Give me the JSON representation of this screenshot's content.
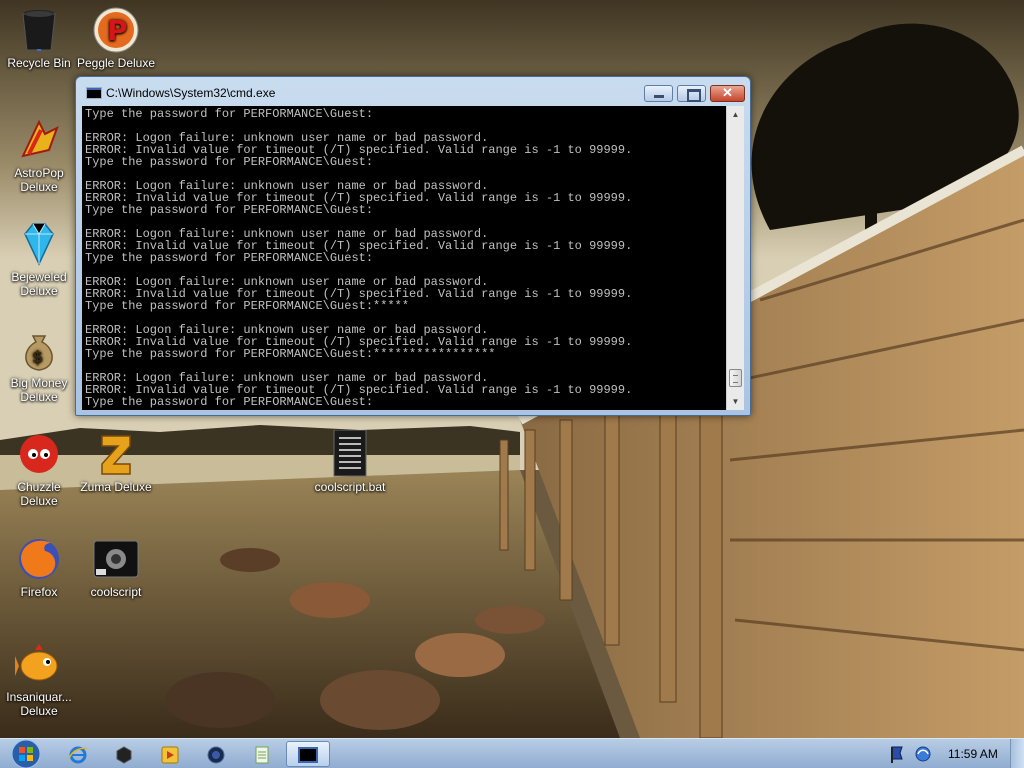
{
  "desktop": {
    "icons": [
      {
        "label": "Recycle Bin",
        "icon": "recycle-bin-icon"
      },
      {
        "label": "Peggle Deluxe",
        "icon": "peggle-icon"
      },
      {
        "label": "AstroPop Deluxe",
        "icon": "astropop-icon"
      },
      {
        "label": "Bejeweled Deluxe",
        "icon": "bejeweled-icon"
      },
      {
        "label": "Big Money Deluxe",
        "icon": "money-bag-icon"
      },
      {
        "label": "Chuzzle Deluxe",
        "icon": "chuzzle-icon"
      },
      {
        "label": "Zuma Deluxe",
        "icon": "zuma-icon"
      },
      {
        "label": "coolscript.bat",
        "icon": "batch-file-icon"
      },
      {
        "label": "Firefox",
        "icon": "firefox-icon"
      },
      {
        "label": "coolscript",
        "icon": "shortcut-icon"
      },
      {
        "label": "Insaniquar... Deluxe",
        "icon": "insaniquarium-icon"
      }
    ]
  },
  "window": {
    "title": "C:\\Windows\\System32\\cmd.exe",
    "console_lines": [
      "Type the password for PERFORMANCE\\Guest:",
      "",
      "ERROR: Logon failure: unknown user name or bad password.",
      "ERROR: Invalid value for timeout (/T) specified. Valid range is -1 to 99999.",
      "Type the password for PERFORMANCE\\Guest:",
      "",
      "ERROR: Logon failure: unknown user name or bad password.",
      "ERROR: Invalid value for timeout (/T) specified. Valid range is -1 to 99999.",
      "Type the password for PERFORMANCE\\Guest:",
      "",
      "ERROR: Logon failure: unknown user name or bad password.",
      "ERROR: Invalid value for timeout (/T) specified. Valid range is -1 to 99999.",
      "Type the password for PERFORMANCE\\Guest:",
      "",
      "ERROR: Logon failure: unknown user name or bad password.",
      "ERROR: Invalid value for timeout (/T) specified. Valid range is -1 to 99999.",
      "Type the password for PERFORMANCE\\Guest:*****",
      "",
      "ERROR: Logon failure: unknown user name or bad password.",
      "ERROR: Invalid value for timeout (/T) specified. Valid range is -1 to 99999.",
      "Type the password for PERFORMANCE\\Guest:*****************",
      "",
      "ERROR: Logon failure: unknown user name or bad password.",
      "ERROR: Invalid value for timeout (/T) specified. Valid range is -1 to 99999.",
      "Type the password for PERFORMANCE\\Guest:"
    ],
    "buttons": {
      "minimize": "minimize-icon",
      "maximize": "maximize-icon",
      "close": "close-icon"
    }
  },
  "taskbar": {
    "start": "windows-start-icon",
    "apps": [
      {
        "icon": "internet-explorer-icon",
        "active": false
      },
      {
        "icon": "cube-app-icon",
        "active": false
      },
      {
        "icon": "media-player-icon",
        "active": false
      },
      {
        "icon": "round-app-icon",
        "active": false
      },
      {
        "icon": "notepad-icon",
        "active": false
      },
      {
        "icon": "cmd-icon",
        "active": true
      }
    ],
    "tray": [
      "security-flag-icon",
      "network-icon"
    ],
    "clock": "11:59 AM"
  },
  "colors": {
    "console_bg": "#000000",
    "console_text": "#c0c0c0",
    "taskbar": "#a9c2e2"
  }
}
